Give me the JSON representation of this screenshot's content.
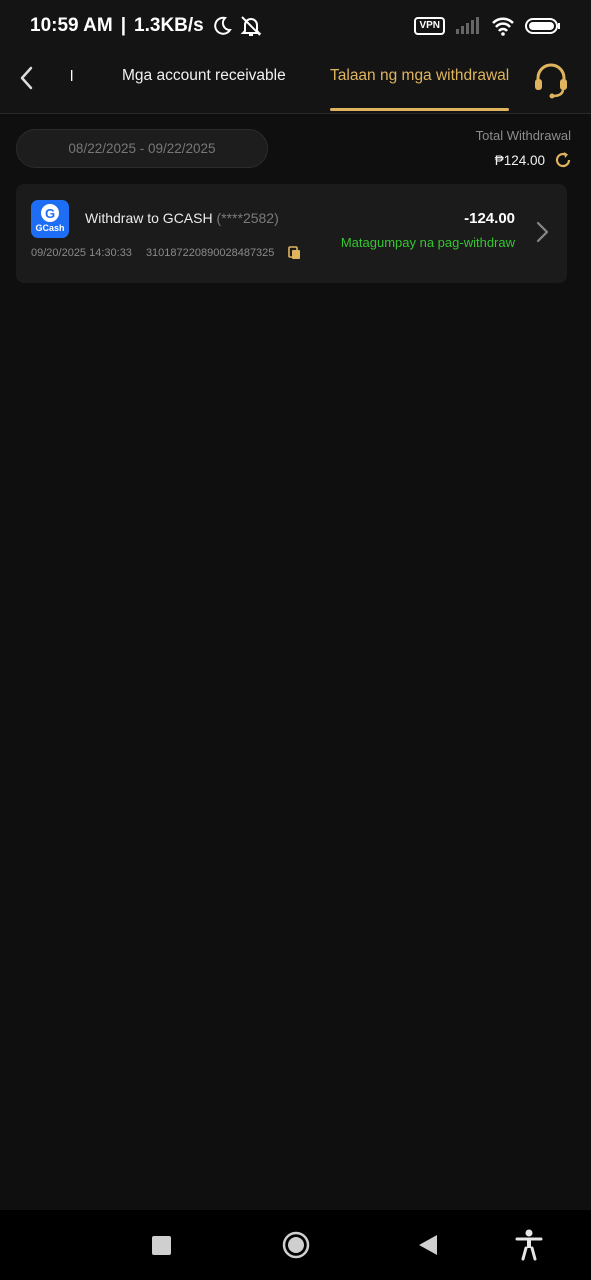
{
  "status_bar": {
    "time": "10:59 AM",
    "separator": "|",
    "speed": "1.3KB/s",
    "vpn": "VPN"
  },
  "header": {
    "partial_tab": "l",
    "tabs": [
      {
        "label": "Mga account receivable",
        "active": false
      },
      {
        "label": "Talaan ng mga withdrawal",
        "active": true
      }
    ],
    "accent_color": "#e0b45e"
  },
  "filter": {
    "date_range": "08/22/2025 - 09/22/2025",
    "total_label": "Total Withdrawal",
    "total_value": "₱124.00"
  },
  "transactions": [
    {
      "method_logo": "GCash",
      "title": "Withdraw to GCASH",
      "account": "(****2582)",
      "datetime": "09/20/2025 14:30:33",
      "reference": "310187220890028487325",
      "amount": "-124.00",
      "status": "Matagumpay na pag-withdraw",
      "status_color": "#36c531"
    }
  ],
  "icons": {
    "back": "chevron-left-icon",
    "support": "headset-icon",
    "refresh": "refresh-icon",
    "copy": "copy-icon",
    "detail": "chevron-right-icon"
  }
}
